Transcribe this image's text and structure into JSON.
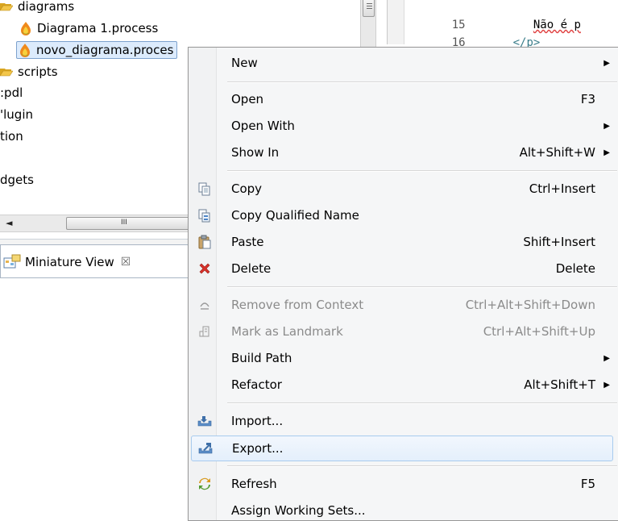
{
  "explorer": {
    "items": [
      {
        "label": "diagrams",
        "icon": "folder-open-icon"
      },
      {
        "label": "Diagrama 1.process",
        "icon": "process-file-icon"
      },
      {
        "label": "novo_diagrama.proces",
        "icon": "process-file-icon",
        "selected": true
      },
      {
        "label": "scripts",
        "icon": "folder-open-icon"
      },
      {
        "label": ":pdl"
      },
      {
        "label": "'lugin"
      },
      {
        "label": "tion"
      },
      {
        "label": "dgets"
      }
    ],
    "hscroll_grip": "III",
    "hscroll_left_arrow": "◄"
  },
  "miniature": {
    "tab_label": "Miniature View",
    "close_glyph": "☒"
  },
  "editor": {
    "lines": [
      {
        "num": "15",
        "text": "Não é p"
      },
      {
        "num": "16",
        "text": "</p>"
      }
    ]
  },
  "context_menu": {
    "items": [
      {
        "label": "New",
        "shortcut": "",
        "submenu": true
      },
      {
        "label": "Open",
        "shortcut": "F3"
      },
      {
        "label": "Open With",
        "shortcut": "",
        "submenu": true
      },
      {
        "label": "Show In",
        "shortcut": "Alt+Shift+W",
        "submenu": true
      },
      {
        "label": "Copy",
        "shortcut": "Ctrl+Insert",
        "icon": "copy-icon"
      },
      {
        "label": "Copy Qualified Name",
        "shortcut": "",
        "icon": "copy-qualified-name-icon"
      },
      {
        "label": "Paste",
        "shortcut": "Shift+Insert",
        "icon": "paste-icon"
      },
      {
        "label": "Delete",
        "shortcut": "Delete",
        "icon": "delete-icon"
      },
      {
        "label": "Remove from Context",
        "shortcut": "Ctrl+Alt+Shift+Down",
        "icon": "remove-context-icon",
        "disabled": true
      },
      {
        "label": "Mark as Landmark",
        "shortcut": "Ctrl+Alt+Shift+Up",
        "icon": "landmark-icon",
        "disabled": true
      },
      {
        "label": "Build Path",
        "shortcut": "",
        "submenu": true
      },
      {
        "label": "Refactor",
        "shortcut": "Alt+Shift+T",
        "submenu": true
      },
      {
        "label": "Import...",
        "shortcut": "",
        "icon": "import-icon"
      },
      {
        "label": "Export...",
        "shortcut": "",
        "icon": "export-icon",
        "highlighted": true
      },
      {
        "label": "Refresh",
        "shortcut": "F5",
        "icon": "refresh-icon"
      },
      {
        "label": "Assign Working Sets...",
        "shortcut": ""
      }
    ],
    "submenu_arrow": "▶"
  },
  "colors": {
    "selection_bg": "#dcebfc",
    "selection_border": "#7da2ce",
    "menu_bg": "#f5f6f7",
    "hover_border": "#a8cbee",
    "disabled_text": "#8b8b8b",
    "delete_red": "#d8312a"
  }
}
